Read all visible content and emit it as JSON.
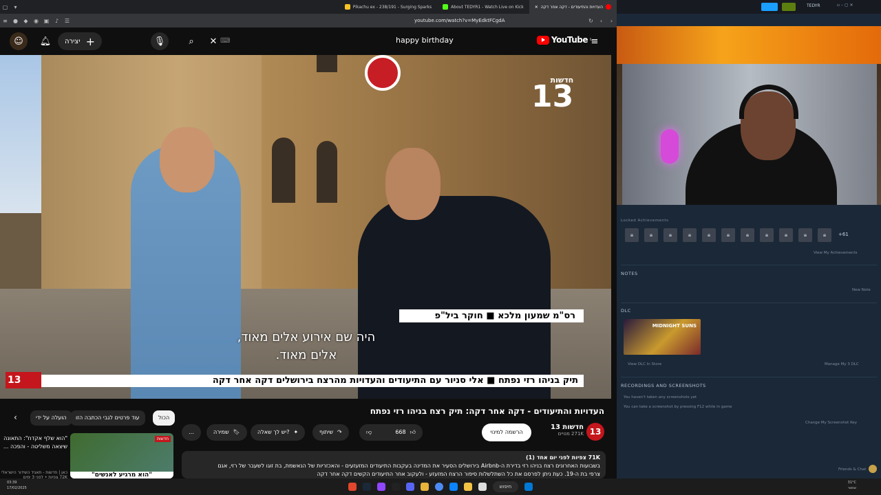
{
  "browser": {
    "tabs": [
      {
        "label": "Pikachu ex - 238/191 - Surging Sparks",
        "color": "#f7c325"
      },
      {
        "label": "About TEDYR1 - Watch Live on Kick",
        "color": "#53fc18"
      },
      {
        "label": "העדויות והתיעודים - דקה אחר דקה",
        "color": "#ff0000"
      }
    ],
    "url": "youtube.com/watch?v=MyEdktFCgdA"
  },
  "youtube": {
    "create_label": "יצירה",
    "search_query": "happy birthday",
    "logo_text": "YouTube",
    "logo_region": "IL"
  },
  "video": {
    "channel_bug_small": "חדשות",
    "channel_bug_number": "13",
    "nameplate": "רס\"מ שמעון מלכא ■ חוקר ביל\"פ",
    "subtitle_line1": "היה שם אירוע אלים מאוד,",
    "subtitle_line2": "אלים מאוד.",
    "ticker": "תיק בניהו רזי נפתח ■ אלי סניור עם התיעודים והעדויות מהרצח בירושלים דקה אחר דקה",
    "ticker_logo": "13"
  },
  "below": {
    "title": "העדויות והתיעודים - דקה אחר דקה: תיק רצח בניהו רזי נפתח",
    "channel_name": "חדשות 13",
    "channel_subs": "271K מנויים",
    "channel_avatar": "13",
    "subscribe_label": "הרשמה למינוי",
    "likes": "668",
    "share_label": "שיתוף",
    "ask_label": "יש לך שאלה?",
    "save_label": "שמירה",
    "more_label": "…",
    "chips": [
      "הכול",
      "עוד פרטים לגבי הכתבה הזו",
      "הועלה על ידי"
    ],
    "description_meta": "71K צפיות  לפני יום אחד (1)",
    "description_line1": "בשבועות האחרונים רצח בניהו רזי בדירת ה-Airbnb בירושלים הסעיר את המדינה בעקבות התיעודים המזעזעים - והאכזריות של הנאשמת, בת זוגו לשעבר של רזי, אגם",
    "description_line2": "צרפי בת ה-19. כעת ניתן לפרסם את כל השתלשלות סיפור הרצח המזעזע - ולעקוב אחר התיעודים הקשים דקה אחר דקה"
  },
  "recommendation": {
    "title": "\"הוא שלף אקדח\": התאונה שיצאה משליטה - והפכה ...",
    "channel": "כאן | חדשות - תאגיד השידור הישראלי",
    "meta": "72K צפיות • לפני 3 ימים",
    "thumb_badge": "חדשות",
    "thumb_caption": "\"הוא מרגיע לאנשים\""
  },
  "steam": {
    "user": "TEDYR",
    "locked_achievements": "Locked Achievements",
    "achievements_more": "+61",
    "view_achievements": "View My Achievements",
    "notes_header": "NOTES",
    "new_note": "New Note",
    "dlc_header": "DLC",
    "dlc_title": "MIDNIGHT SUNS",
    "view_dlc": "View DLC In Store",
    "manage_dlc": "Manage My 3 DLC",
    "rec_header": "RECORDINGS AND SCREENSHOTS",
    "rec_line1": "You haven't taken any screenshots yet",
    "rec_line2": "You can take a screenshot by pressing F12 while in game",
    "change_key": "Change My Screenshot Key",
    "friends_chat": "Friends & Chat"
  },
  "taskbar": {
    "time_left": "03:39",
    "date_left": "17/02/2025",
    "search_label": "חיפוש",
    "weather": "31°C",
    "weather_desc": "שמשי"
  }
}
